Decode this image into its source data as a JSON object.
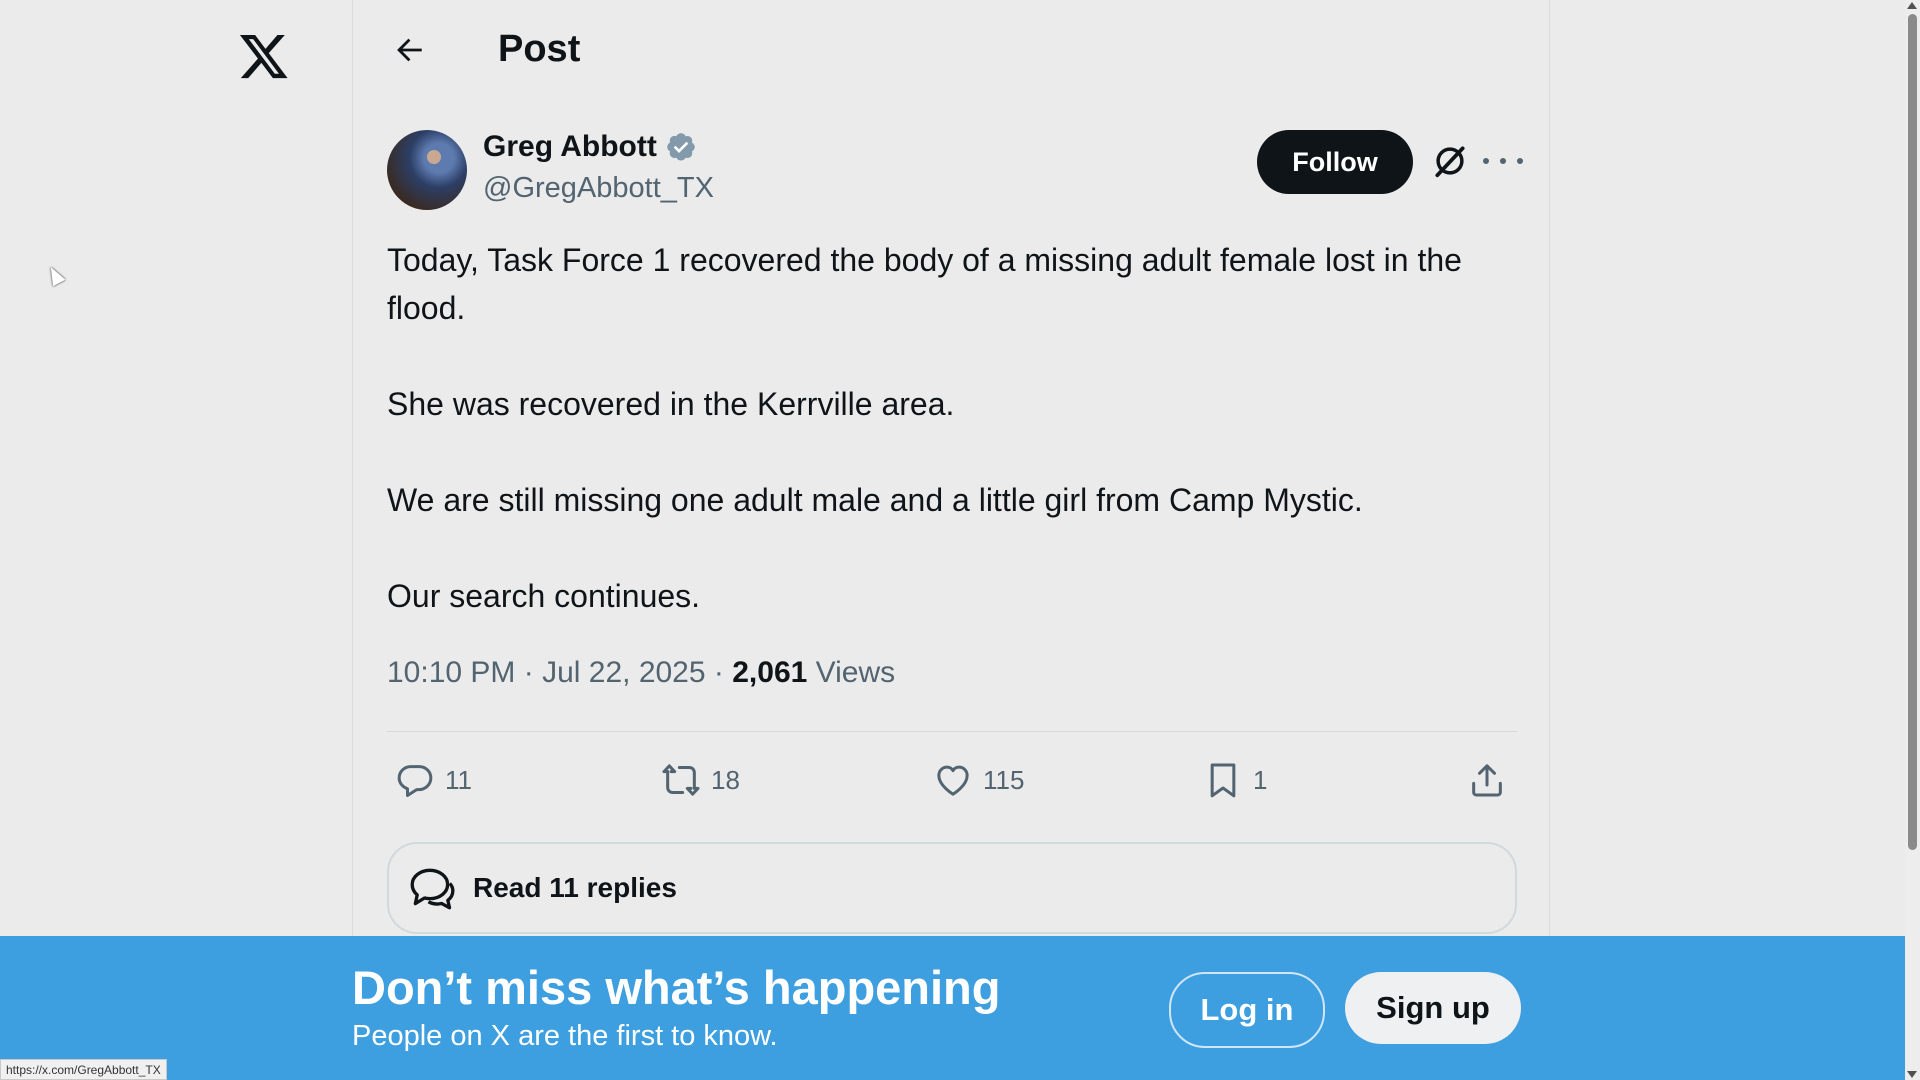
{
  "header": {
    "title": "Post"
  },
  "author": {
    "name": "Greg Abbott",
    "handle": "@GregAbbott_TX"
  },
  "buttons": {
    "follow": "Follow"
  },
  "tweet": {
    "paragraphs": [
      "Today, Task Force 1 recovered the body of a missing adult female lost in the flood.",
      "She was recovered in the Kerrville area.",
      "We are still missing one adult male and a little girl from Camp Mystic.",
      "Our search continues."
    ],
    "time": "10:10 PM",
    "date": "Jul 22, 2025",
    "views_count": "2,061",
    "views_label": "Views"
  },
  "actions": {
    "replies": "11",
    "reposts": "18",
    "likes": "115",
    "bookmarks": "1"
  },
  "read_replies": "Read 11 replies",
  "banner": {
    "title": "Don’t miss what’s happening",
    "subtitle": "People on X are the first to know.",
    "login": "Log in",
    "signup": "Sign up"
  },
  "status_url": "https://x.com/GregAbbott_TX",
  "colors": {
    "banner": "#3d9ee0",
    "verified": "#829aab",
    "text": "#0f1419",
    "muted": "#536471"
  }
}
